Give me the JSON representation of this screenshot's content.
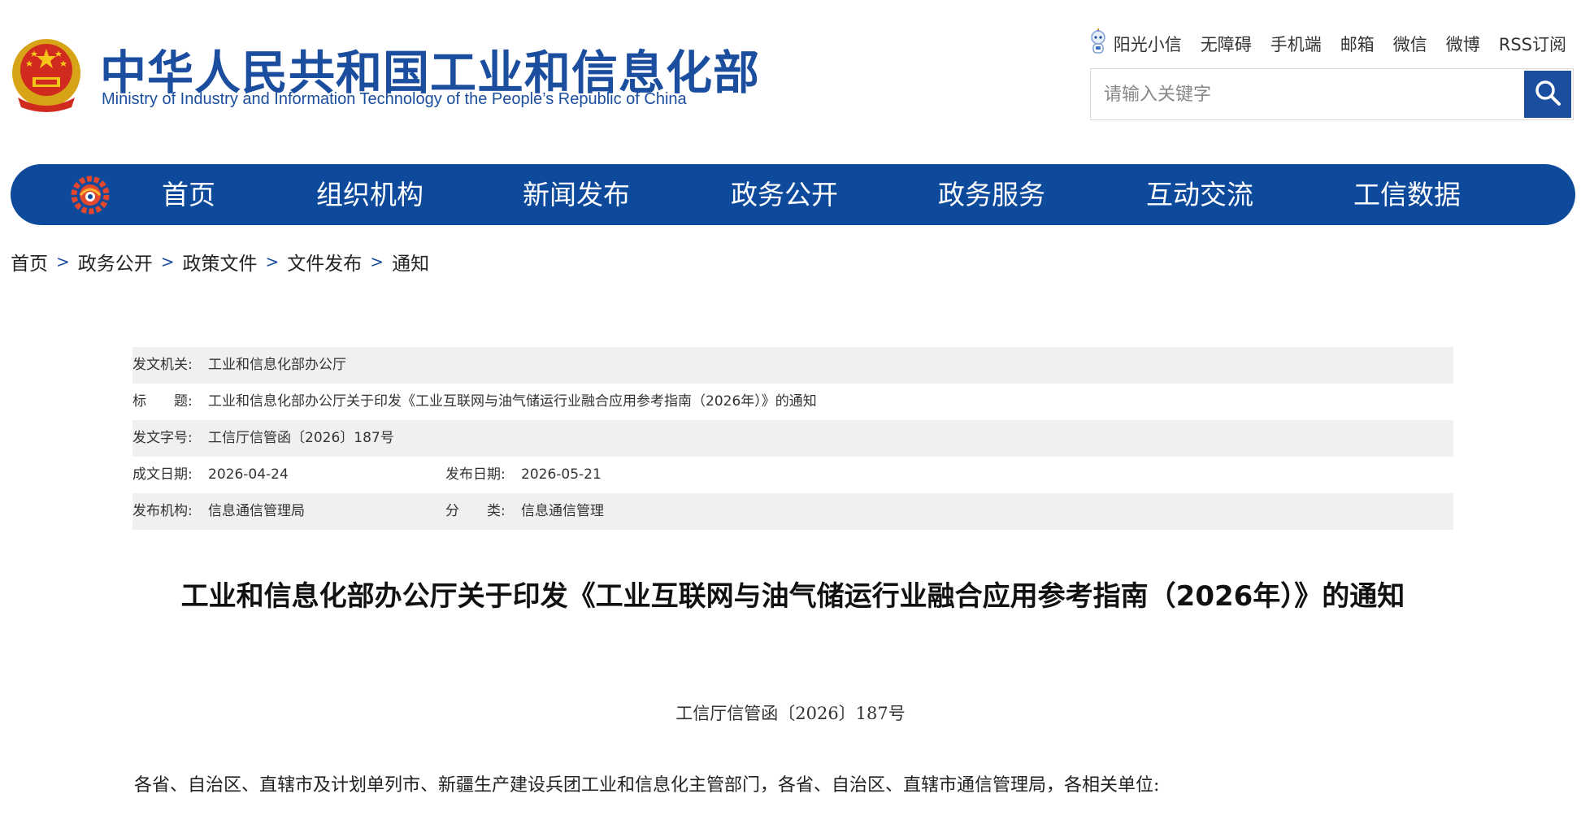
{
  "header": {
    "title_cn": "中华人民共和国工业和信息化部",
    "title_en": "Ministry of Industry and Information Technology of the People’s Republic of China",
    "top_links": [
      "阳光小信",
      "无障碍",
      "手机端",
      "邮箱",
      "微信",
      "微博",
      "RSS订阅"
    ],
    "search_placeholder": "请输入关键字"
  },
  "nav": {
    "items": [
      "首页",
      "组织机构",
      "新闻发布",
      "政务公开",
      "政务服务",
      "互动交流",
      "工信数据"
    ]
  },
  "breadcrumb": [
    "首页",
    "政务公开",
    "政策文件",
    "文件发布",
    "通知"
  ],
  "meta": {
    "issuer_label": "发文机关:",
    "issuer": "工业和信息化部办公厅",
    "title_label": "标　　题:",
    "title": "工业和信息化部办公厅关于印发《工业互联网与油气储运行业融合应用参考指南（2026年）》的通知",
    "docno_label": "发文字号:",
    "docno": "工信厅信管函〔2026〕187号",
    "created_label": "成文日期:",
    "created": "2026-04-24",
    "published_label": "发布日期:",
    "published": "2026-05-21",
    "org_label": "发布机构:",
    "org": "信息通信管理局",
    "category_label": "分　　类:",
    "category": "信息通信管理"
  },
  "content": {
    "title": "工业和信息化部办公厅关于印发《工业互联网与油气储运行业融合应用参考指南（2026年）》的通知",
    "doc_number": "工信厅信管函〔2026〕187号",
    "recipients": "各省、自治区、直辖市及计划单列市、新疆生产建设兵团工业和信息化主管部门，各省、自治区、直辖市通信管理局，各相关单位:"
  },
  "colors": {
    "brand_blue": "#1b4e9e",
    "nav_blue": "#0d4a9b",
    "row_shade": "#f0f0f0"
  },
  "icons": [
    "national-emblem-icon",
    "robot-icon",
    "search-icon",
    "gear-logo-icon"
  ]
}
